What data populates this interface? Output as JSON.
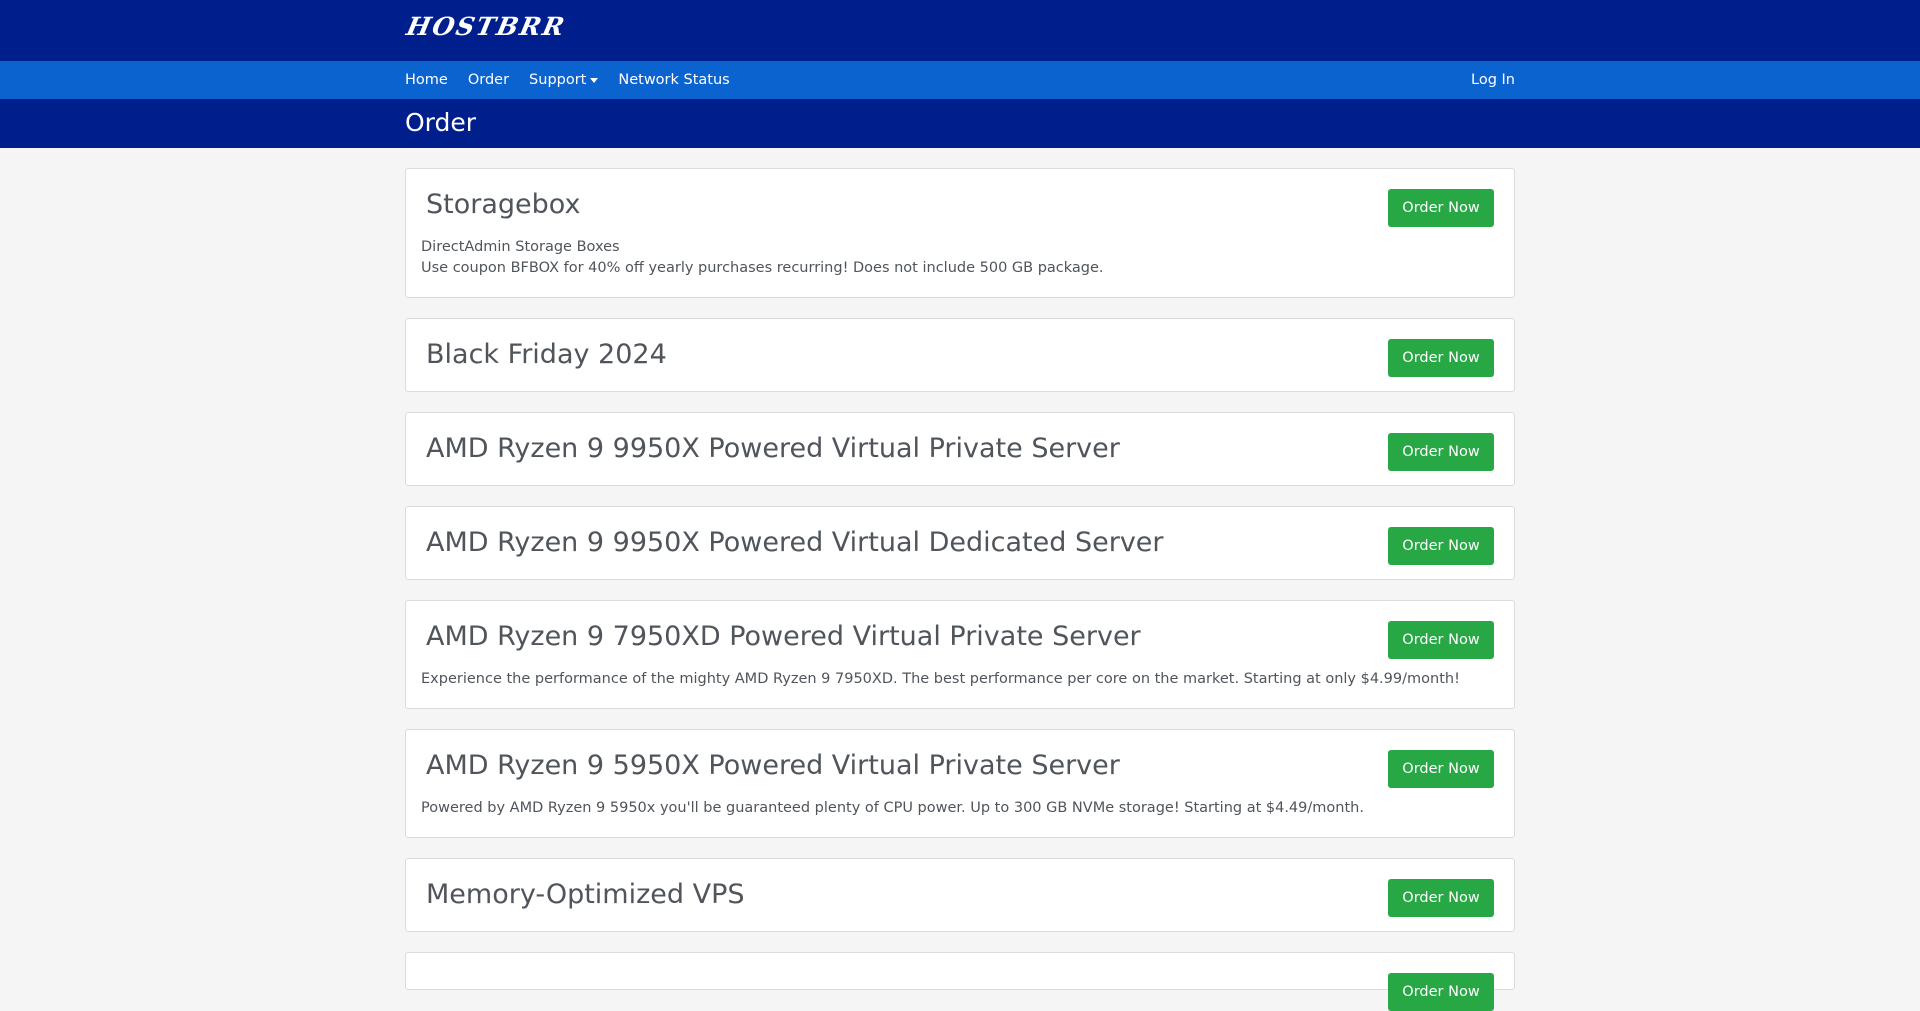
{
  "brand": {
    "logo_text": "HOSTBRR"
  },
  "nav": {
    "items": [
      {
        "label": "Home"
      },
      {
        "label": "Order"
      },
      {
        "label": "Support",
        "dropdown": true
      },
      {
        "label": "Network Status"
      }
    ],
    "login_label": "Log In"
  },
  "page": {
    "title": "Order"
  },
  "products": [
    {
      "title": "Storagebox",
      "description": [
        "DirectAdmin Storage Boxes",
        "Use coupon BFBOX for 40% off yearly purchases recurring! Does not include 500 GB package."
      ],
      "button": "Order Now"
    },
    {
      "title": "Black Friday 2024",
      "description": [],
      "button": "Order Now"
    },
    {
      "title": "AMD Ryzen 9 9950X Powered Virtual Private Server",
      "description": [],
      "button": "Order Now"
    },
    {
      "title": "AMD Ryzen 9 9950X Powered Virtual Dedicated Server",
      "description": [],
      "button": "Order Now"
    },
    {
      "title": "AMD Ryzen 9 7950XD Powered Virtual Private Server",
      "description": [
        "Experience the performance of the mighty AMD Ryzen 9 7950XD. The best performance per core on the market. Starting at only $4.99/month!"
      ],
      "button": "Order Now"
    },
    {
      "title": "AMD Ryzen 9 5950X Powered Virtual Private Server",
      "description": [
        "Powered by AMD Ryzen 9 5950x you'll be guaranteed plenty of CPU power. Up to 300 GB NVMe storage! Starting at $4.49/month."
      ],
      "button": "Order Now"
    },
    {
      "title": "Memory-Optimized VPS",
      "description": [],
      "button": "Order Now"
    },
    {
      "title": "",
      "description": [],
      "button": "Order Now"
    }
  ],
  "colors": {
    "topbar": "#001e8c",
    "navbar": "#0a63cf",
    "order_button": "#28a745",
    "background": "#f5f5f5"
  }
}
